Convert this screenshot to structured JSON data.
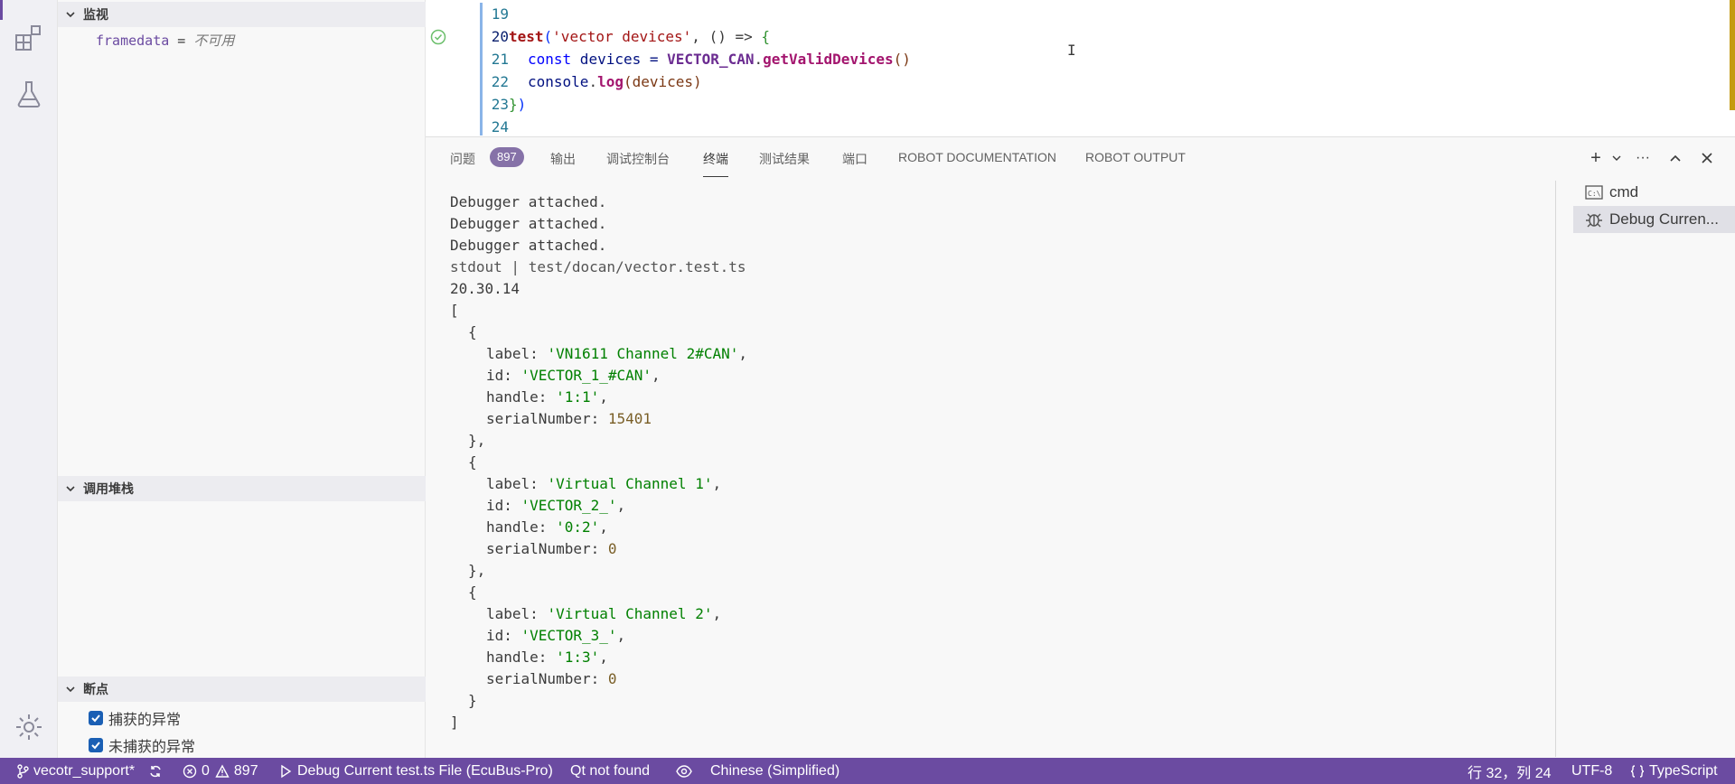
{
  "sidebar": {
    "watch": {
      "title": "监视",
      "items": [
        {
          "name": "framedata",
          "eq": " = ",
          "value": "不可用"
        }
      ]
    },
    "callstack": {
      "title": "调用堆栈"
    },
    "breakpoints": {
      "title": "断点",
      "items": [
        {
          "label": "捕获的异常",
          "checked": true
        },
        {
          "label": "未捕获的异常",
          "checked": true
        }
      ]
    }
  },
  "editor": {
    "line_numbers": [
      "19",
      "20",
      "21",
      "22",
      "23",
      "24"
    ],
    "line20": {
      "fn": "test",
      "open": "(",
      "str": "'vector devices'",
      "rest": ", () => ",
      "brace": "{"
    },
    "line21": {
      "kw": "const",
      "var": " devices = ",
      "cls": "VECTOR_CAN",
      "dot": ".",
      "method": "getValidDevices",
      "parens": "()"
    },
    "line22": {
      "obj": "console",
      "dot": ".",
      "method": "log",
      "args": "(devices)"
    },
    "line23": {
      "brace": "}",
      "paren": ")"
    }
  },
  "panel": {
    "tabs": [
      "问题",
      "输出",
      "调试控制台",
      "终端",
      "测试结果",
      "端口",
      "ROBOT DOCUMENTATION",
      "ROBOT OUTPUT"
    ],
    "active_tab": "终端",
    "problems_count": "897",
    "actions": {
      "add": "+",
      "more": "···"
    },
    "terminal_lines": [
      "Debugger attached.",
      "Debugger attached.",
      "Debugger attached.",
      "stdout | test/docan/vector.test.ts",
      "20.30.14",
      "["
    ],
    "devices": [
      {
        "label": "'VN1611 Channel 2#CAN'",
        "id": "'VECTOR_1_#CAN'",
        "handle": "'1:1'",
        "serialNumber": "15401"
      },
      {
        "label": "'Virtual Channel 1'",
        "id": "'VECTOR_2_'",
        "handle": "'0:2'",
        "serialNumber": "0"
      },
      {
        "label": "'Virtual Channel 2'",
        "id": "'VECTOR_3_'",
        "handle": "'1:3'",
        "serialNumber": "0"
      }
    ],
    "keys": {
      "label": "label: ",
      "id": "id: ",
      "handle": "handle: ",
      "serial": "serialNumber: "
    },
    "close_bracket": "]",
    "terminals": [
      {
        "name": "cmd",
        "icon": "cmd-icon"
      },
      {
        "name": "Debug Curren...",
        "icon": "bug-icon"
      }
    ]
  },
  "status_bar": {
    "branch": "vecotr_support*",
    "errors": "0",
    "warnings": "897",
    "debug": "Debug Current test.ts File (EcuBus-Pro)",
    "qt": "Qt not found",
    "language_pack": "Chinese (Simplified)",
    "position": "行 32，列 24",
    "encoding": "UTF-8",
    "language": "TypeScript"
  },
  "colors": {
    "accent": "#6b4ba1",
    "badge": "#8672a8",
    "string": "#008000"
  }
}
